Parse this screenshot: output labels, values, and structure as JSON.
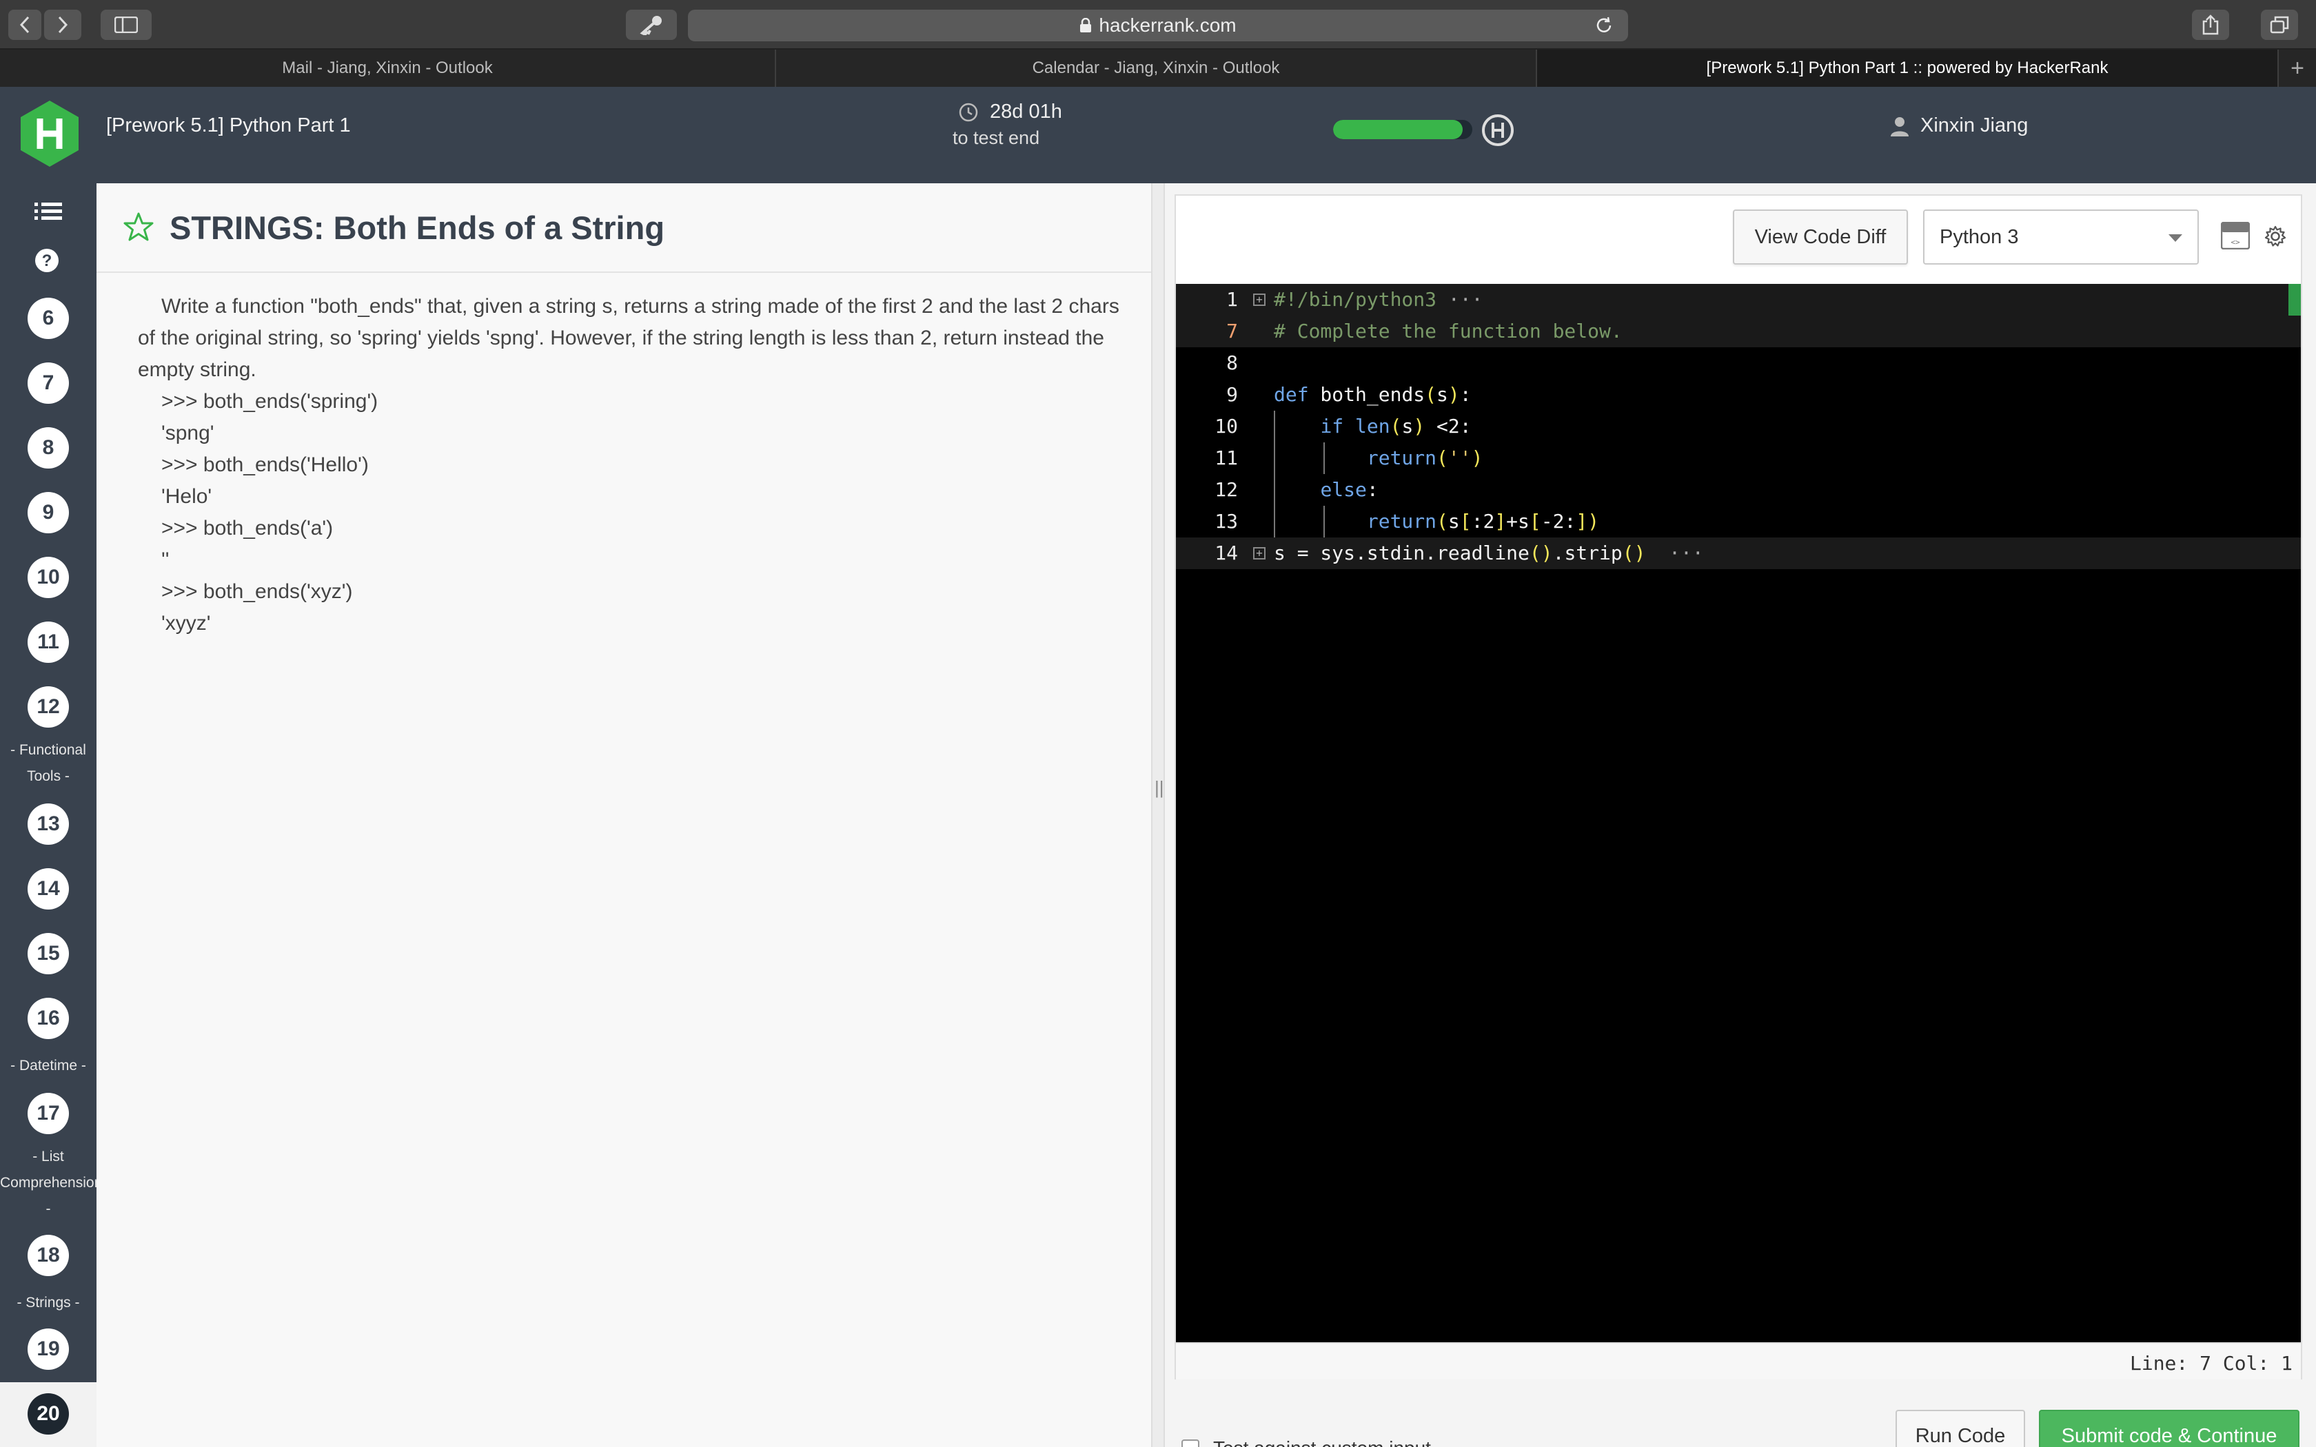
{
  "browser": {
    "url": "hackerrank.com",
    "tabs": [
      {
        "label": "Mail - Jiang, Xinxin - Outlook",
        "active": false
      },
      {
        "label": "Calendar - Jiang, Xinxin - Outlook",
        "active": false
      },
      {
        "label": "[Prework 5.1] Python Part 1 :: powered by HackerRank",
        "active": true
      }
    ],
    "new_tab": "+"
  },
  "header": {
    "title": "[Prework 5.1] Python Part 1",
    "timer_value": "28d 01h",
    "timer_caption": "to test end",
    "progress_fraction": 0.93,
    "user_name": "Xinxin Jiang",
    "colors": {
      "header_bg": "#39424e",
      "brand_green": "#39b54a"
    }
  },
  "sidebar": {
    "items": [
      {
        "num": "6"
      },
      {
        "num": "7"
      },
      {
        "num": "8"
      },
      {
        "num": "9"
      },
      {
        "num": "10"
      },
      {
        "num": "11"
      },
      {
        "num": "12"
      },
      {
        "num": "13"
      },
      {
        "num": "14"
      },
      {
        "num": "15"
      },
      {
        "num": "16"
      },
      {
        "num": "17"
      },
      {
        "num": "18"
      },
      {
        "num": "19"
      },
      {
        "num": "20",
        "current": true
      }
    ],
    "sections": {
      "functional_1": "- Functional",
      "functional_2": "Tools -",
      "datetime": "- Datetime -",
      "list_1": "- List",
      "list_2": "Comprehension",
      "list_3": "-",
      "strings": "- Strings -"
    }
  },
  "problem": {
    "title": "STRINGS: Both Ends of a String",
    "description": "Write a function \"both_ends\" that, given a string s, returns a string made of the first 2 and the last 2 chars of the original string, so 'spring' yields 'spng'. However, if the string length is less than 2, return instead the empty string.",
    "examples": [
      ">>> both_ends('spring')",
      "'spng'",
      ">>> both_ends('Hello')",
      "'Helo'",
      ">>> both_ends('a')",
      "''",
      ">>> both_ends('xyz')",
      "'xyyz'"
    ]
  },
  "editor": {
    "view_diff_label": "View Code Diff",
    "language": "Python 3",
    "line_numbers": [
      "1",
      "7",
      "8",
      "9",
      "10",
      "11",
      "12",
      "13",
      "14"
    ],
    "status": "Line: 7 Col: 1",
    "run_label": "Run Code",
    "submit_label": "Submit code & Continue",
    "custom_input_label": "Test against custom input"
  }
}
